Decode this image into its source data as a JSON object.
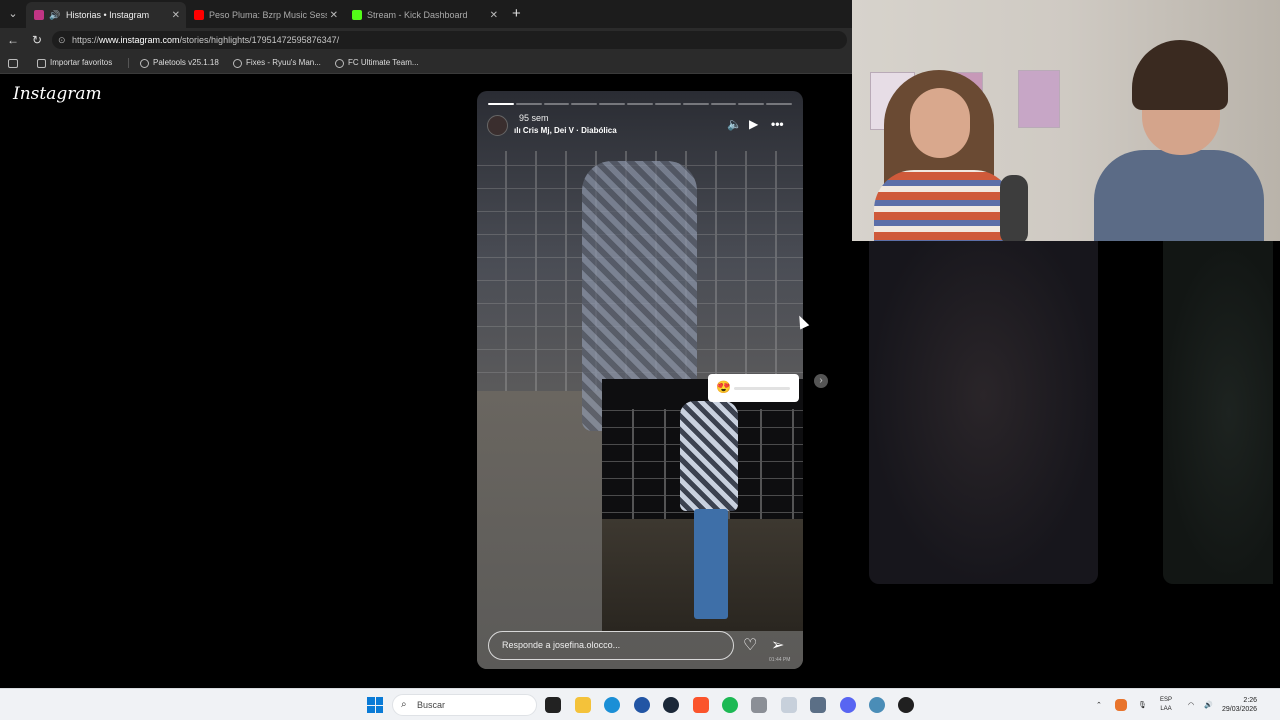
{
  "browser": {
    "tabs": [
      {
        "title": "Historias • Instagram",
        "active": true,
        "favicon_color": "#c13584"
      },
      {
        "title": "Peso Pluma: Bzrp Music Sessions",
        "active": false,
        "favicon_color": "#ff0000"
      },
      {
        "title": "Stream - Kick Dashboard",
        "active": false,
        "favicon_color": "#53fc18"
      }
    ],
    "url_prefix": "https://",
    "url_host": "www.instagram.com",
    "url_path": "/stories/highlights/17951472595876347/",
    "bookmarks": [
      "Importar favoritos",
      "Paletools v25.1.18",
      "Fixes - Ryuu's Man...",
      "FC Ultimate Team..."
    ]
  },
  "instagram": {
    "logo": "Instagram",
    "story": {
      "time_ago": "95 sem",
      "music": "Cris Mj, Dei V · Diabólica",
      "reply_placeholder": "Responde a josefina.olocco...",
      "slider_emoji": "😍",
      "watermark": "01:44 PM"
    }
  },
  "taskbar": {
    "search_placeholder": "Buscar",
    "lang_line1": "ESP",
    "lang_line2": "LAA",
    "time": "2:26",
    "date": "29/03/2026"
  },
  "colors": {
    "accent": "#0a7bd6",
    "chrome": "#2b2b2b"
  }
}
